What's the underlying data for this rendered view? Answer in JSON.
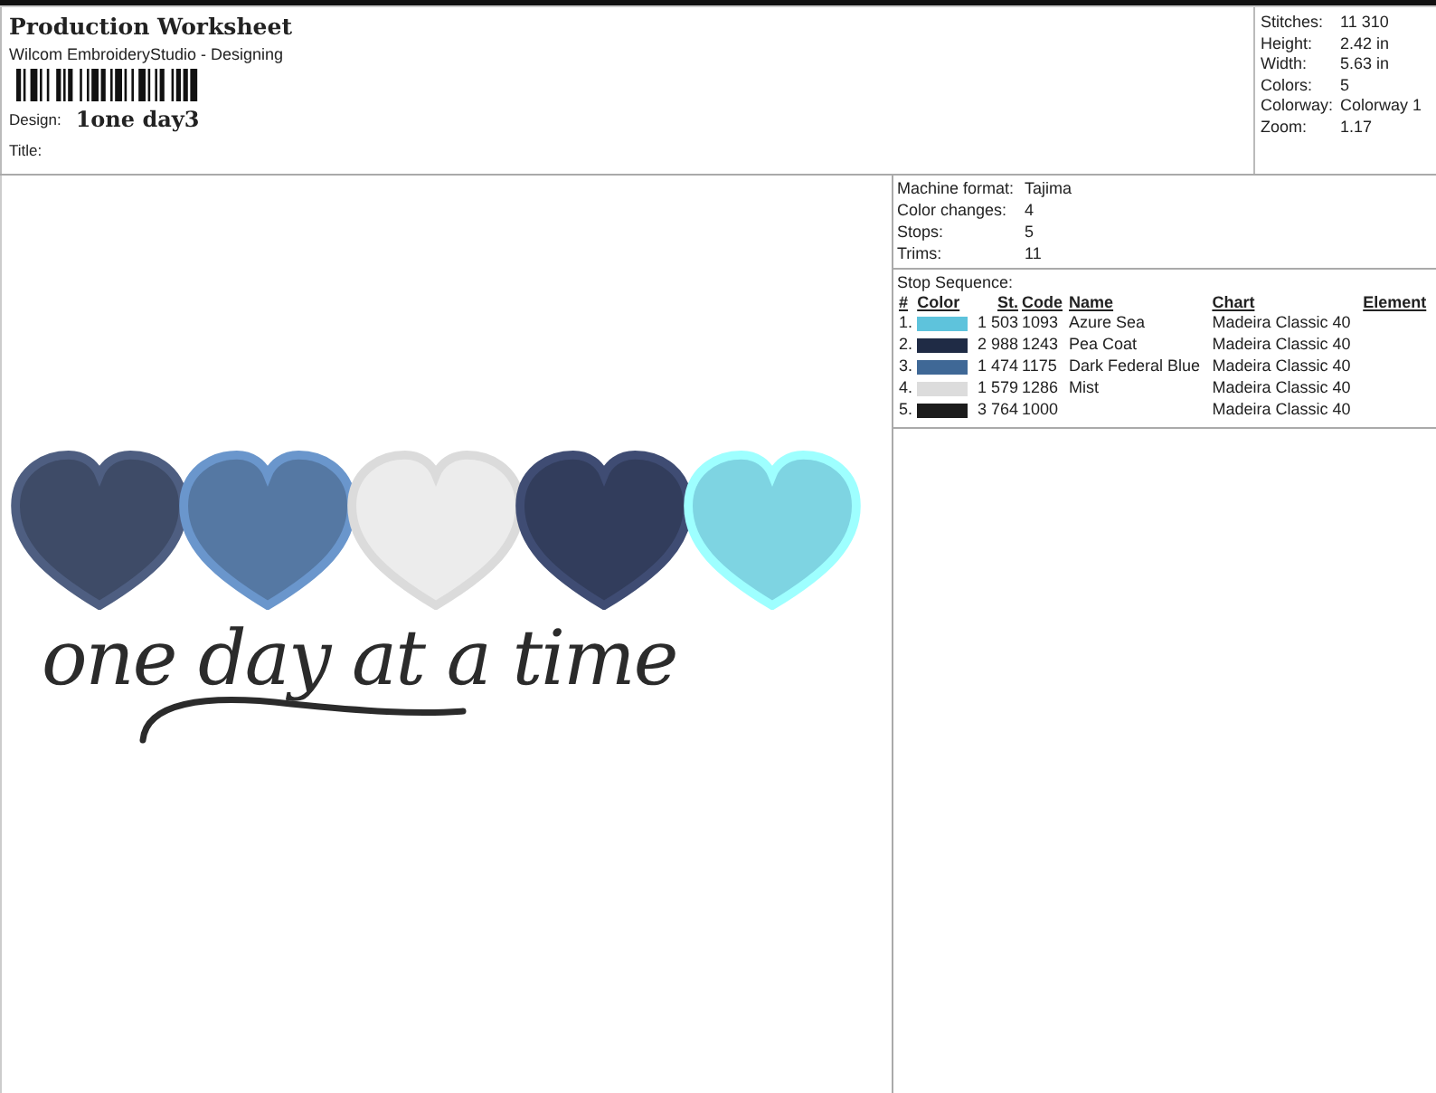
{
  "header": {
    "title": "Production Worksheet",
    "software": "Wilcom EmbroideryStudio - Designing",
    "design_label": "Design:",
    "design_name": "1one day3",
    "title_label": "Title:"
  },
  "summary": [
    {
      "label": "Stitches:",
      "value": "11 310"
    },
    {
      "label": "Height:",
      "value": "2.42 in"
    },
    {
      "label": "Width:",
      "value": "5.63 in"
    },
    {
      "label": "Colors:",
      "value": "5"
    },
    {
      "label": "Colorway:",
      "value": "Colorway 1"
    },
    {
      "label": "Zoom:",
      "value": "1.17"
    }
  ],
  "design": {
    "hearts": [
      {
        "color": "#3e4b67"
      },
      {
        "color": "#5578a3"
      },
      {
        "color": "#ececec"
      },
      {
        "color": "#323d5c"
      },
      {
        "color": "#7ed4e2"
      }
    ],
    "lettering": "one day at a time"
  },
  "machine_info": [
    {
      "label": "Machine format:",
      "value": "Tajima"
    },
    {
      "label": "Color changes:",
      "value": "4"
    },
    {
      "label": "Stops:",
      "value": "5"
    },
    {
      "label": "Trims:",
      "value": "11"
    }
  ],
  "stop_sequence": {
    "title": "Stop Sequence:",
    "columns": [
      "#",
      "Color",
      "St.",
      "Code",
      "Name",
      "Chart",
      "Element"
    ],
    "rows": [
      {
        "index": "1.",
        "color": "#5ec3dc",
        "stitches": "1 503",
        "code": "1093",
        "name": "Azure Sea",
        "chart": "Madeira Classic 40"
      },
      {
        "index": "2.",
        "color": "#1f2b45",
        "stitches": "2 988",
        "code": "1243",
        "name": "Pea Coat",
        "chart": "Madeira Classic 40"
      },
      {
        "index": "3.",
        "color": "#3f6896",
        "stitches": "1 474",
        "code": "1175",
        "name": "Dark Federal Blue",
        "chart": "Madeira Classic 40"
      },
      {
        "index": "4.",
        "color": "#dcdcdc",
        "stitches": "1 579",
        "code": "1286",
        "name": "Mist",
        "chart": "Madeira Classic 40"
      },
      {
        "index": "5.",
        "color": "#1c1c1c",
        "stitches": "3 764",
        "code": "1000",
        "name": "",
        "chart": "Madeira Classic 40"
      }
    ]
  }
}
